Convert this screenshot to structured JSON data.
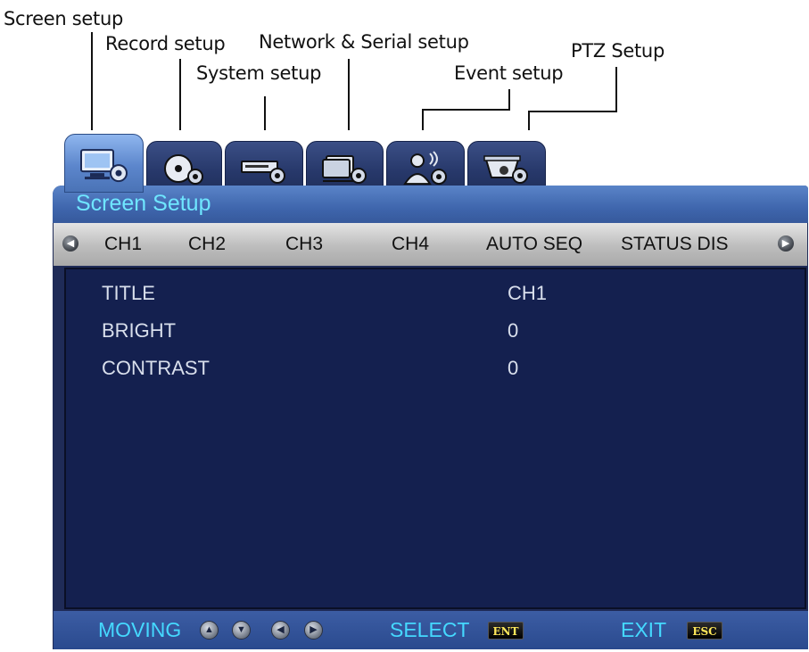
{
  "annotations": {
    "screen_setup": "Screen setup",
    "record_setup": "Record setup",
    "system_setup": "System setup",
    "network_setup": "Network & Serial setup",
    "event_setup": "Event setup",
    "ptz_setup": "PTZ Setup"
  },
  "tabs": [
    {
      "icon": "monitor-gear-icon",
      "active": true
    },
    {
      "icon": "disc-gear-icon",
      "active": false
    },
    {
      "icon": "dvr-gear-icon",
      "active": false
    },
    {
      "icon": "network-gear-icon",
      "active": false
    },
    {
      "icon": "person-gear-icon",
      "active": false
    },
    {
      "icon": "ptz-camera-gear-icon",
      "active": false
    }
  ],
  "window": {
    "title": "Screen Setup"
  },
  "channel_bar": {
    "items": [
      "CH1",
      "CH2",
      "CH3",
      "CH4",
      "AUTO SEQ",
      "STATUS DIS"
    ],
    "selected": "CH1"
  },
  "settings": [
    {
      "label": "TITLE",
      "value": "CH1"
    },
    {
      "label": "BRIGHT",
      "value": "0"
    },
    {
      "label": "CONTRAST",
      "value": "0"
    }
  ],
  "footer": {
    "moving_label": "MOVING",
    "select_label": "SELECT",
    "select_key": "ENT",
    "exit_label": "EXIT",
    "exit_key": "ESC"
  },
  "colors": {
    "title_text": "#6fe6ff",
    "footer_text": "#45d9ff",
    "panel_bg": "#14204f",
    "key_text": "#ffe85a"
  }
}
